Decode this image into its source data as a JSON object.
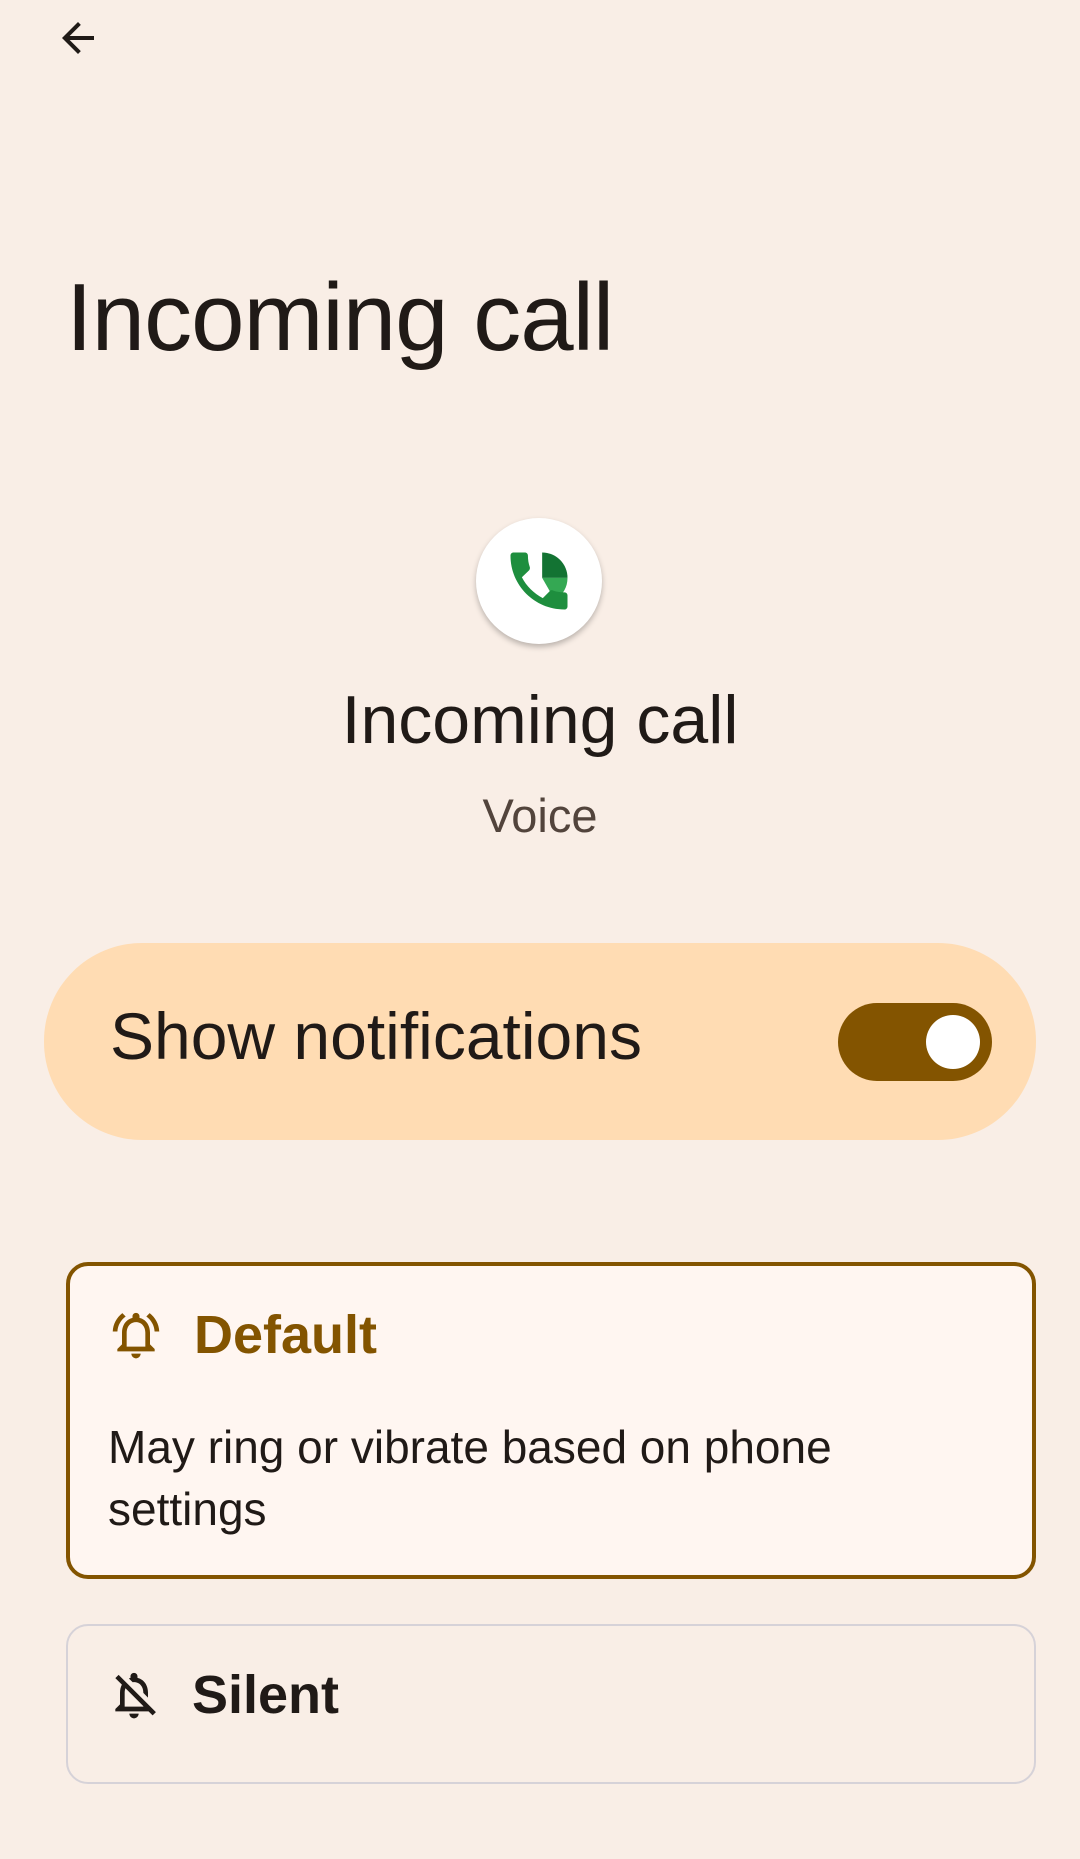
{
  "header": {
    "back_icon": "arrow-back-icon"
  },
  "page": {
    "title": "Incoming call"
  },
  "channel": {
    "icon": "phone-call-app-icon",
    "name": "Incoming call",
    "app": "Voice"
  },
  "show_notifications": {
    "label": "Show notifications",
    "enabled": true
  },
  "options": {
    "default": {
      "icon": "bell-icon",
      "title": "Default",
      "description": "May ring or vibrate based on phone settings",
      "selected": true
    },
    "silent": {
      "icon": "bell-off-icon",
      "title": "Silent",
      "selected": false
    }
  },
  "colors": {
    "background": "#f9eee6",
    "accent": "#835400",
    "toggle_card": "#ffdcb3",
    "selected_card": "#fff6f1"
  }
}
